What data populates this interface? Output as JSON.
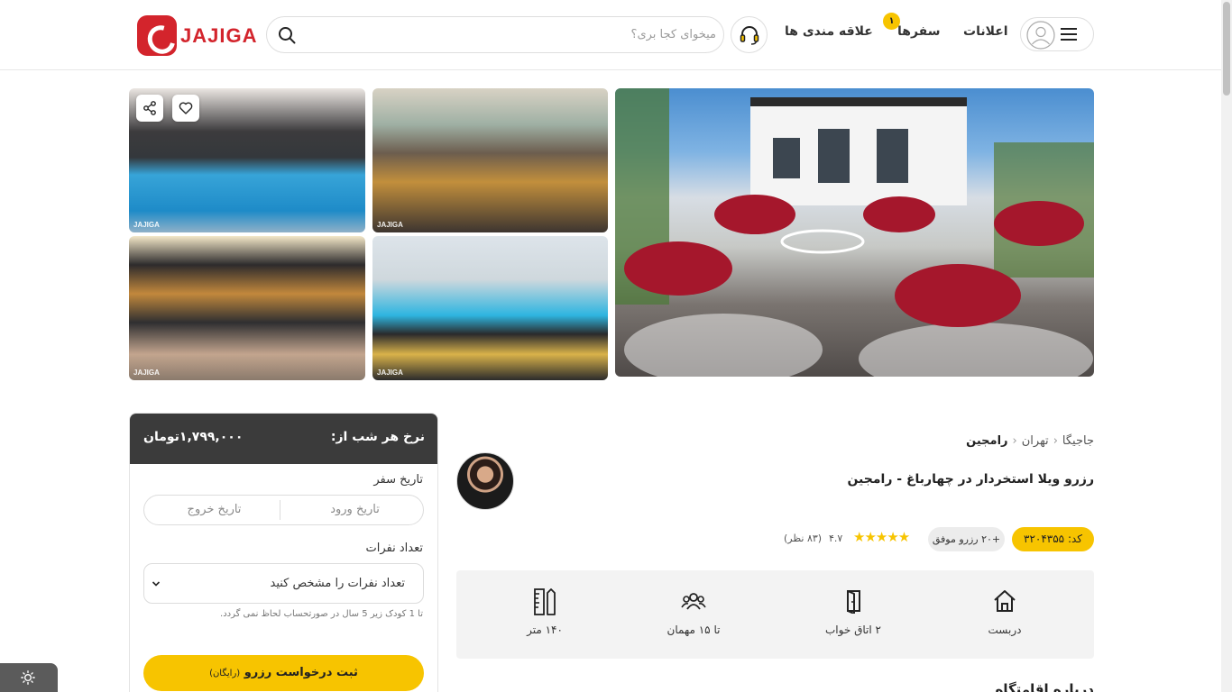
{
  "header": {
    "brand": "JAJIGA",
    "search_placeholder": "میخوای کجا بری؟",
    "nav": {
      "favorites": "علاقه مندی ها",
      "trips": "سفرها",
      "trips_badge": "۱",
      "notifications": "اعلانات"
    }
  },
  "gallery": {
    "watermark": "JAJIGA",
    "photos": [
      "villa-terrace",
      "pool",
      "living-room",
      "kitchen",
      "bedroom"
    ]
  },
  "booking": {
    "price_label": "نرخ هر شب از:",
    "price_value": "۱,۷۹۹,۰۰۰تومان",
    "trip_date_label": "تاریخ سفر",
    "check_in": "تاریخ ورود",
    "check_out": "تاریخ خروج",
    "guests_label": "تعداد نفرات",
    "guests_select": "تعداد نفرات را مشخص کنید",
    "child_note": "تا 1 کودک زیر 5 سال در صورتحساب لحاظ نمی گردد.",
    "reserve_button": "ثبت درخواست رزرو",
    "reserve_free": "(رایگان)"
  },
  "listing": {
    "breadcrumb": [
      "جاجیگا",
      "تهران",
      "رامجین"
    ],
    "title": "رزرو ویلا استخردار در چهارباغ - رامجین",
    "code": "کد: ۳۲۰۴۳۵۵",
    "success_badge": "+۲۰ رزرو موفق",
    "stars": "★★★★★",
    "rating": "۴.۷",
    "rating_count": "(۸۳ نظر)",
    "features": [
      {
        "icon": "house-icon",
        "label": "دربست"
      },
      {
        "icon": "door-icon",
        "label": "۲ اتاق خواب"
      },
      {
        "icon": "guests-icon",
        "label": "تا ۱۵ مهمان"
      },
      {
        "icon": "ruler-icon",
        "label": "۱۴۰ متر"
      }
    ],
    "about_title": "درباره اقامتگاه"
  },
  "colors": {
    "brand_red": "#d3242c",
    "accent_yellow": "#f7c400",
    "price_bar": "#3b3b3b"
  }
}
